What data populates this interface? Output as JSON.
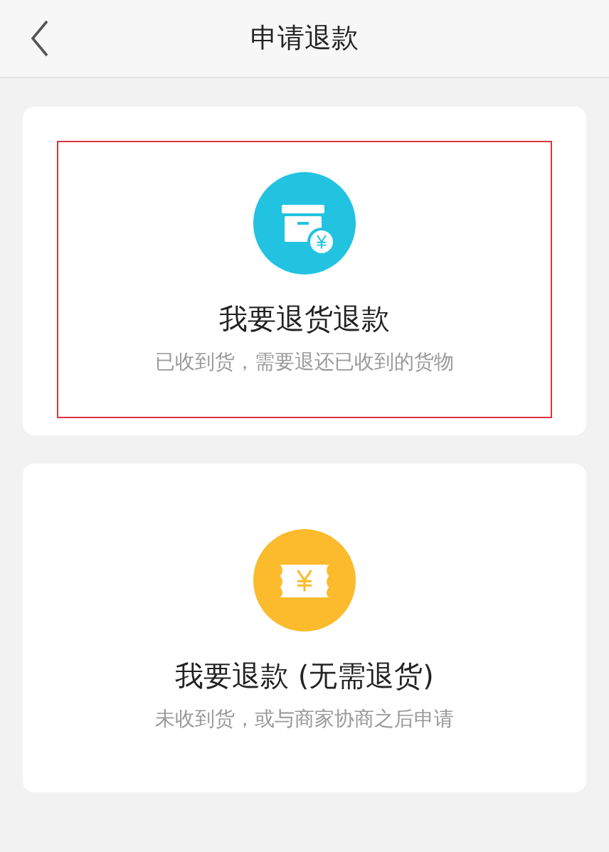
{
  "header": {
    "title": "申请退款"
  },
  "options": [
    {
      "kind": "box",
      "title": "我要退货退款",
      "subtitle": "已收到货，需要退还已收到的货物",
      "selected": true
    },
    {
      "kind": "ticket",
      "title": "我要退款 (无需退货)",
      "subtitle": "未收到货，或与商家协商之后申请",
      "selected": false
    }
  ]
}
